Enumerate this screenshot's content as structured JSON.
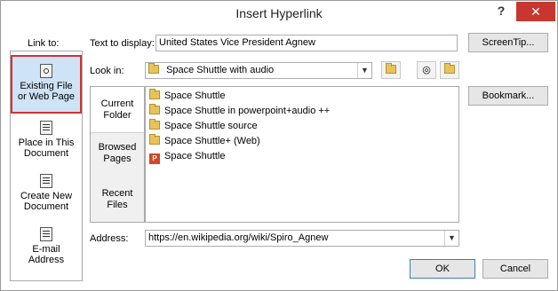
{
  "window": {
    "title": "Insert Hyperlink",
    "help_glyph": "?",
    "close_glyph": "✕"
  },
  "link_to": {
    "label": "Link to:",
    "items": [
      {
        "line1": "Existing File",
        "line2": "or Web Page",
        "icon": "globe-page-icon",
        "selected": true
      },
      {
        "line1": "Place in This",
        "line2": "Document",
        "icon": "document-place-icon",
        "selected": false
      },
      {
        "line1": "Create New",
        "line2": "Document",
        "icon": "new-document-icon",
        "selected": false
      },
      {
        "line1": "E-mail",
        "line2": "Address",
        "icon": "email-icon",
        "selected": false
      }
    ]
  },
  "text_to_display": {
    "label": "Text to display:",
    "value": "United States Vice President Agnew"
  },
  "screentip_button": "ScreenTip...",
  "look_in": {
    "label": "Look in:",
    "value": "Space Shuttle with audio"
  },
  "nav": {
    "items": [
      {
        "line1": "Current",
        "line2": "Folder"
      },
      {
        "line1": "Browsed",
        "line2": "Pages"
      },
      {
        "line1": "Recent",
        "line2": "Files"
      }
    ]
  },
  "files": [
    {
      "name": "Space Shuttle",
      "type": "folder"
    },
    {
      "name": "Space Shuttle in powerpoint+audio ++",
      "type": "folder"
    },
    {
      "name": "Space Shuttle source",
      "type": "folder"
    },
    {
      "name": "Space Shuttle+ (Web)",
      "type": "folder"
    },
    {
      "name": "Space Shuttle",
      "type": "powerpoint"
    }
  ],
  "bookmark_button": "Bookmark...",
  "address": {
    "label": "Address:",
    "value": "https://en.wikipedia.org/wiki/Spiro_Agnew"
  },
  "ok_button": "OK",
  "cancel_button": "Cancel"
}
